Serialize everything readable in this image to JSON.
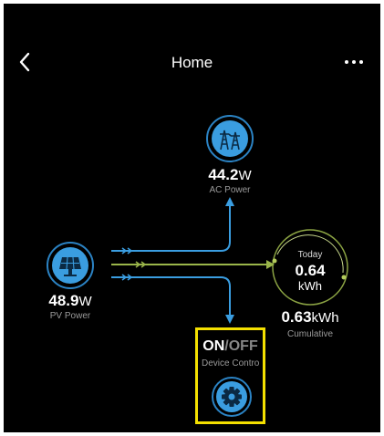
{
  "header": {
    "title": "Home",
    "back_icon": "chevron-left-icon",
    "more_icon": "more-horizontal-icon"
  },
  "ac_power": {
    "value": "44.2",
    "unit": "W",
    "label": "AC Power",
    "icon": "power-tower-icon"
  },
  "pv_power": {
    "value": "48.9",
    "unit": "W",
    "label": "PV Power",
    "icon": "solar-panel-icon"
  },
  "energy": {
    "today_label": "Today",
    "today_value": "0.64",
    "today_unit": "kWh",
    "cumulative_value": "0.63",
    "cumulative_unit": "kWh",
    "cumulative_label": "Cumulative"
  },
  "device_control": {
    "on_label": "ON",
    "separator": "/",
    "off_label": "OFF",
    "label": "Device Contro",
    "icon": "gear-icon"
  },
  "colors": {
    "background": "#000000",
    "accent_blue": "#3a9de0",
    "ring_blue": "#2b83c4",
    "flow_green": "#9ab54a",
    "highlight_yellow": "#f4e000"
  }
}
